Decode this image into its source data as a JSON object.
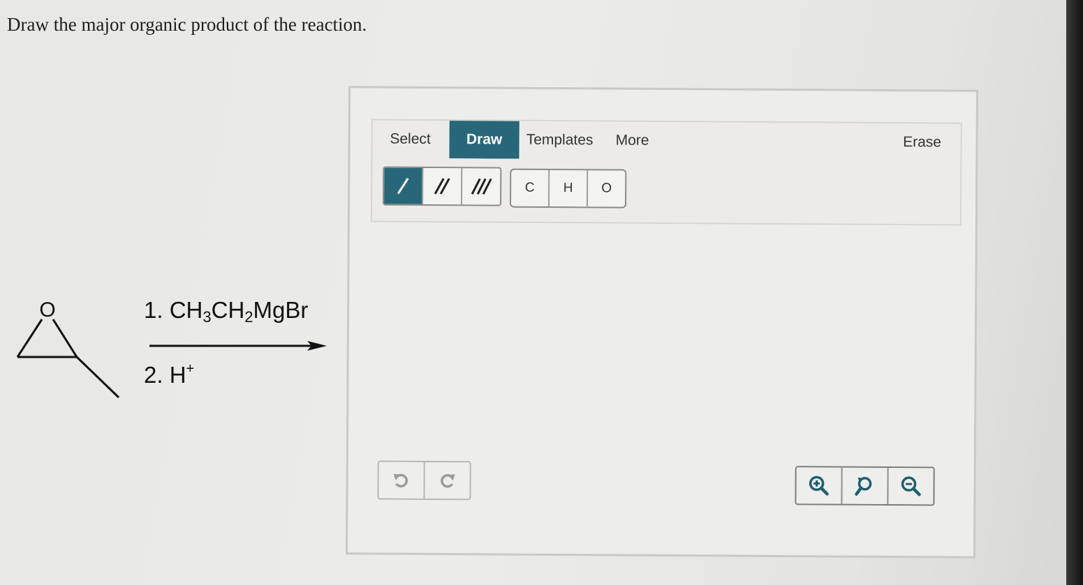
{
  "question": {
    "text": "Draw the major organic product of the reaction."
  },
  "reaction": {
    "starting_atom": "O",
    "reagent1_prefix": "1. CH",
    "reagent1_sub1": "3",
    "reagent1_mid": "CH",
    "reagent1_sub2": "2",
    "reagent1_suffix": "MgBr",
    "reagent2_prefix": "2. H",
    "reagent2_sup": "+"
  },
  "sketcher": {
    "tabs": {
      "select": "Select",
      "draw": "Draw",
      "templates": "Templates",
      "more": "More",
      "erase": "Erase"
    },
    "active_tab": "Draw",
    "bond_tools": [
      "single-bond-icon",
      "double-bond-icon",
      "triple-bond-icon"
    ],
    "atoms": [
      "C",
      "H",
      "O"
    ],
    "history_tools": [
      "undo-icon",
      "redo-icon"
    ],
    "zoom_tools": [
      "zoom-in-icon",
      "reset-zoom-icon",
      "zoom-out-icon"
    ]
  },
  "colors": {
    "accent": "#276779",
    "background": "#ececea"
  }
}
